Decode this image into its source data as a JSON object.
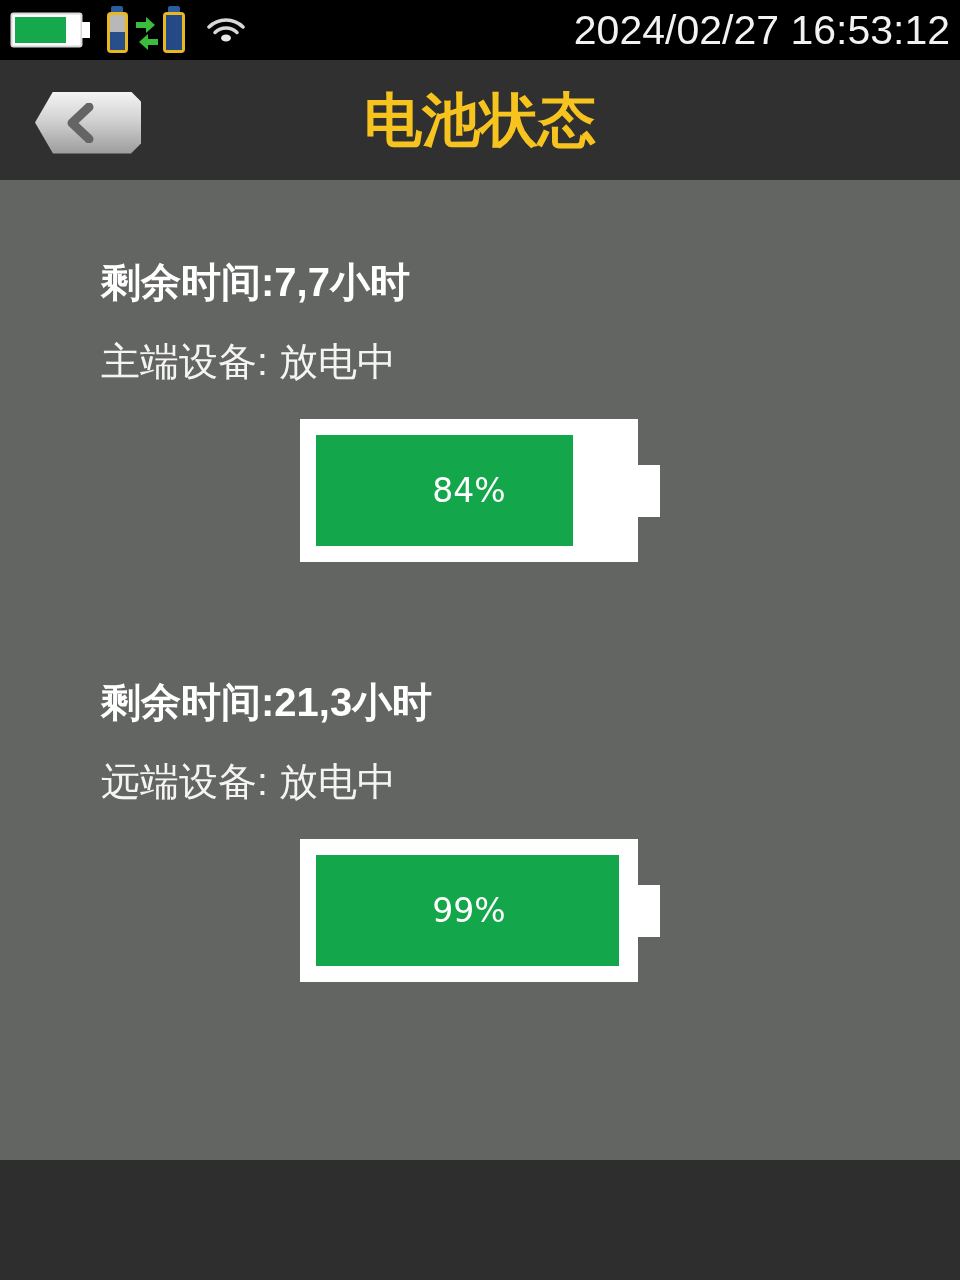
{
  "status_bar": {
    "datetime": "2024/02/27 16:53:12"
  },
  "header": {
    "title": "电池状态"
  },
  "devices": [
    {
      "remaining": "剩余时间:7,7小时",
      "status": "主端设备: 放电中",
      "level": 0.84,
      "reading": "84%"
    },
    {
      "remaining": "剩余时间:21,3小时",
      "status": "远端设备: 放电中",
      "level": 0.99,
      "reading": "99%"
    }
  ]
}
